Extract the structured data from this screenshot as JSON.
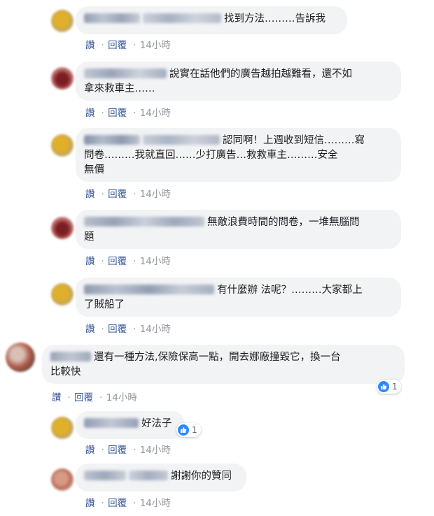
{
  "actions": {
    "like": "讚",
    "reply": "回覆",
    "separator": "·"
  },
  "colors": {
    "bubble": "#f2f3f5",
    "link": "#385898",
    "like_blue": "#2d88ff"
  },
  "comments": [
    {
      "text": "找到方法………告訴我",
      "time": "14小時"
    },
    {
      "text_line1": "說實在話他們的廣告越拍越難看，還不如",
      "text_line2": "拿來救車主……",
      "time": "14小時"
    },
    {
      "text_line1": "認同啊！上週收到短信………寫",
      "text_line2": "問卷………我就直回……少打廣告…救救車主………安全",
      "text_line3": "無價",
      "time": "14小時"
    },
    {
      "text_line1": "無敵浪費時間的問卷，一堆無腦問",
      "text_line2": "題",
      "time": "14小時"
    },
    {
      "text_line1": "有什麼辦 法呢？………大家都上",
      "text_line2": "了賊船了",
      "time": "14小時"
    },
    {
      "text_line1": "還有一種方法,保險保高一點，開去娜廠撞毀它，換一台",
      "text_line2": "比較快",
      "time": "14小時",
      "reaction_count": "1"
    },
    {
      "text": "好法子",
      "time": "14小時",
      "reaction_count": "1"
    },
    {
      "text": "謝謝你的贊同",
      "time": "14小時"
    }
  ]
}
